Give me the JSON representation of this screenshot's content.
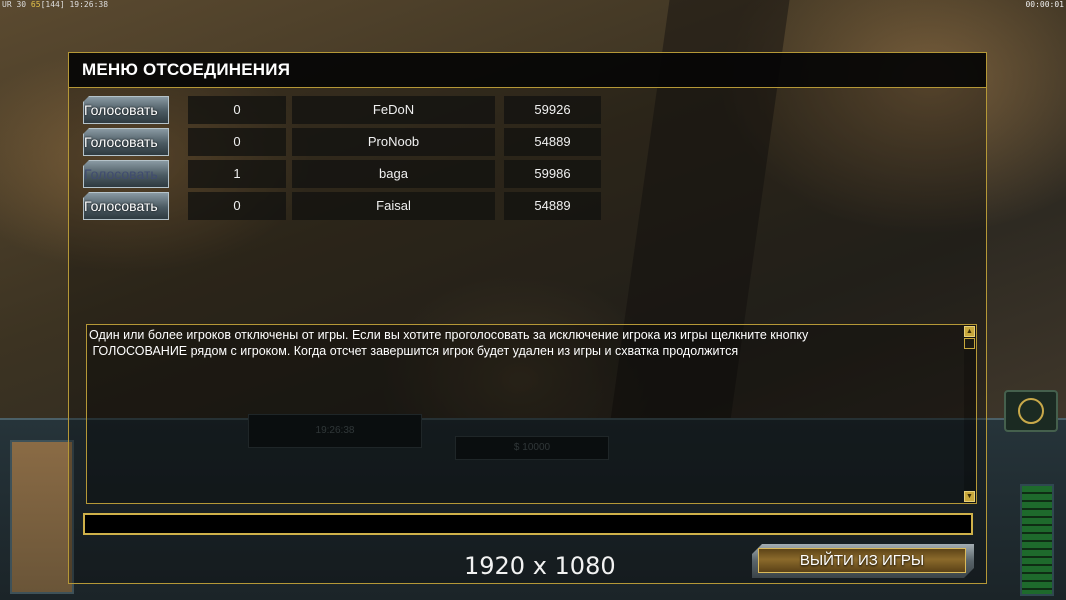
{
  "hud": {
    "top_left_prefix": "UR 30",
    "top_left_yellow": "65",
    "top_left_bracket": "[144]",
    "top_left_time": "19:26:38",
    "top_right_timer": "00:00:01",
    "game_time": "19:26:38",
    "money": "$ 10000",
    "resolution_label": "1920 x 1080"
  },
  "dialog": {
    "title": "МЕНЮ ОТСОЕДИНЕНИЯ",
    "players": [
      {
        "vote_label": "Голосовать",
        "votes": "0",
        "name": "FeDoN",
        "ping": "59926",
        "vote_enabled": true
      },
      {
        "vote_label": "Голосовать",
        "votes": "0",
        "name": "ProNoob",
        "ping": "54889",
        "vote_enabled": true
      },
      {
        "vote_label": "Голосовать",
        "votes": "1",
        "name": "baga",
        "ping": "59986",
        "vote_enabled": false
      },
      {
        "vote_label": "Голосовать",
        "votes": "0",
        "name": "Faisal",
        "ping": "54889",
        "vote_enabled": true
      }
    ],
    "info_text": "Один или более игроков отключены от игры. Если вы хотите проголосовать за исключение игрока из игры щелкните кнопку\n ГОЛОСОВАНИЕ рядом с игроком. Когда отсчет завершится игрок будет удален из игры и схватка продолжится",
    "chat_value": "",
    "quit_label": "ВЫЙТИ ИЗ ИГРЫ"
  },
  "colors": {
    "accent_gold": "#b59837",
    "dialog_bg": "#080806"
  },
  "icons": [
    "scroll-up-icon",
    "scroll-down-icon",
    "radar-icon"
  ]
}
